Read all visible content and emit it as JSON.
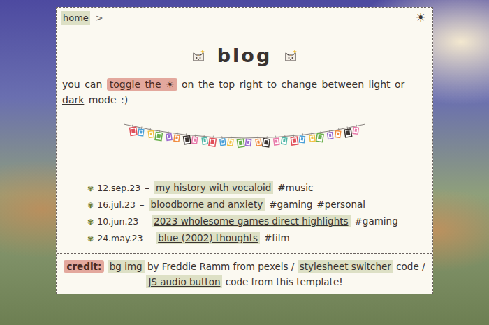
{
  "breadcrumb": {
    "home": "home",
    "separator": ">"
  },
  "theme_toggle": "☀",
  "title": "blog",
  "intro": [
    {
      "text": "you can",
      "kind": "plain"
    },
    {
      "text": "toggle the ☀",
      "kind": "highlight"
    },
    {
      "text": "on the top right to change between",
      "kind": "plain"
    },
    {
      "text": "light",
      "kind": "link"
    },
    {
      "text": "or",
      "kind": "plain"
    },
    {
      "text": "dark",
      "kind": "link"
    },
    {
      "text": "mode :)",
      "kind": "plain"
    }
  ],
  "posts": [
    {
      "bullet": "✾",
      "date": "12.sep.23",
      "dash": "–",
      "title": "my history with vocaloid",
      "tags": [
        "#music"
      ]
    },
    {
      "bullet": "✾",
      "date": "16.jul.23",
      "dash": "–",
      "title": "bloodborne and anxiety",
      "tags": [
        "#gaming",
        "#personal"
      ]
    },
    {
      "bullet": "✾",
      "date": "10.jun.23",
      "dash": "–",
      "title": "2023 wholesome games direct highlights",
      "tags": [
        "#gaming"
      ]
    },
    {
      "bullet": "✾",
      "date": "24.may.23",
      "dash": "–",
      "title": "blue (2002) thoughts",
      "tags": [
        "#film"
      ]
    }
  ],
  "credits": [
    {
      "text": "credit:",
      "kind": "highlight"
    },
    {
      "text": "bg img",
      "kind": "link"
    },
    {
      "text": "by Freddie Ramm from pexels /",
      "kind": "plain"
    },
    {
      "text": "stylesheet switcher",
      "kind": "link"
    },
    {
      "text": "code /",
      "kind": "plain"
    },
    {
      "text": "JS audio button",
      "kind": "link"
    },
    {
      "text": "code from this template!",
      "kind": "plain"
    }
  ]
}
